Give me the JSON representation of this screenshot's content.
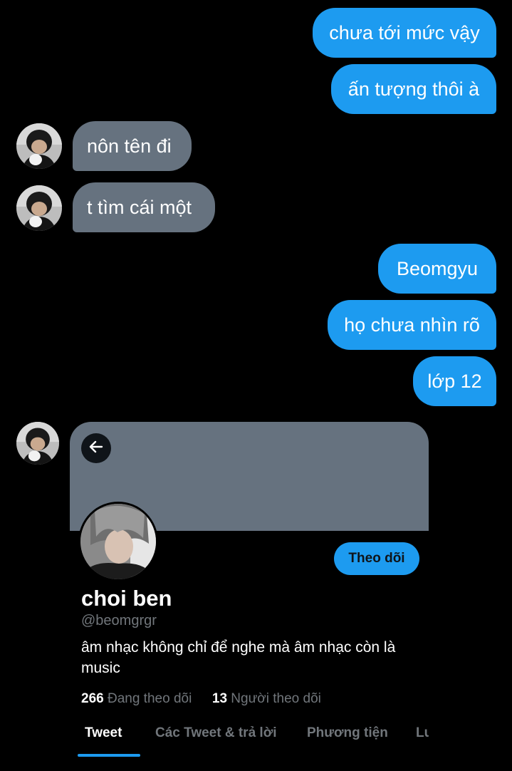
{
  "conversation": {
    "messages": [
      {
        "side": "sent",
        "text": "chưa tới mức vậy"
      },
      {
        "side": "sent",
        "text": "ấn tượng thôi à"
      },
      {
        "side": "received",
        "text": "nôn tên đi"
      },
      {
        "side": "received",
        "text": "t tìm cái một"
      },
      {
        "side": "sent",
        "text": "Beomgyu"
      },
      {
        "side": "sent",
        "text": "họ chưa nhìn rõ"
      },
      {
        "side": "sent",
        "text": "lớp 12"
      }
    ]
  },
  "profile_card": {
    "display_name": "choi ben",
    "handle": "@beomgrgr",
    "bio": "âm nhạc không chỉ để nghe mà âm nhạc còn là music",
    "follow_button": "Theo dõi",
    "following_count": "266",
    "following_label": "Đang theo dõi",
    "followers_count": "13",
    "followers_label": "Người theo dõi",
    "tabs": [
      {
        "label": "Tweet",
        "active": true
      },
      {
        "label": "Các Tweet & trả lời",
        "active": false
      },
      {
        "label": "Phương tiện",
        "active": false
      },
      {
        "label": "Lượt thích",
        "active": false
      }
    ]
  },
  "colors": {
    "sent_bubble": "#1d9bf0",
    "received_bubble": "#66727f",
    "background": "#000000",
    "muted_text": "#71767b"
  },
  "icons": {
    "back": "arrow-left-icon"
  }
}
